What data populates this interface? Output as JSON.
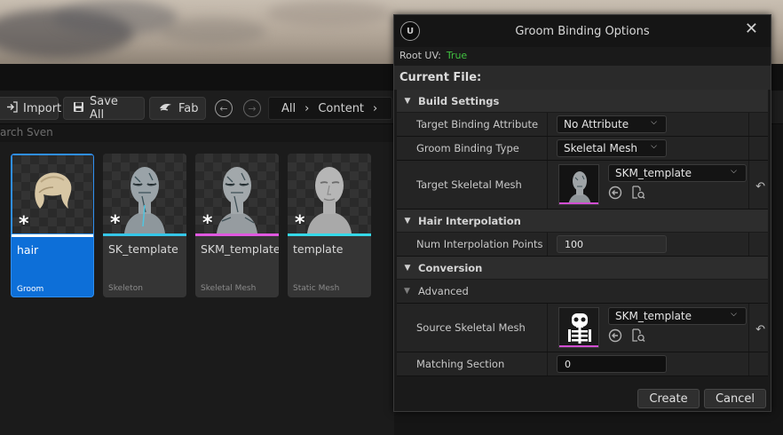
{
  "toolbar": {
    "import_label": "Import",
    "save_all_label": "Save All",
    "fab_label": "Fab",
    "breadcrumb": [
      "All",
      "Content"
    ]
  },
  "search": {
    "placeholder": "arch Sven"
  },
  "assets": [
    {
      "name": "hair",
      "type": "Groom",
      "accent": "#ffffff",
      "selected": true
    },
    {
      "name": "SK_template",
      "type": "Skeleton",
      "accent": "#35c6e8",
      "selected": false
    },
    {
      "name": "SKM_template",
      "type": "Skeletal Mesh",
      "accent": "#e058e0",
      "selected": false
    },
    {
      "name": "template",
      "type": "Static Mesh",
      "accent": "#35d8e8",
      "selected": false
    }
  ],
  "dialog": {
    "title": "Groom Binding Options",
    "root_uv_label": "Root UV:",
    "root_uv_value": "True",
    "current_file_label": "Current File:",
    "build_settings": {
      "label": "Build Settings",
      "target_binding_attribute": {
        "label": "Target Binding Attribute",
        "value": "No Attribute"
      },
      "groom_binding_type": {
        "label": "Groom Binding Type",
        "value": "Skeletal Mesh"
      },
      "target_skeletal_mesh": {
        "label": "Target Skeletal Mesh",
        "value": "SKM_template"
      }
    },
    "hair_interpolation": {
      "label": "Hair Interpolation",
      "num_interpolation_points": {
        "label": "Num Interpolation Points",
        "value": "100"
      }
    },
    "conversion": {
      "label": "Conversion",
      "advanced_label": "Advanced",
      "source_skeletal_mesh": {
        "label": "Source Skeletal Mesh",
        "value": "SKM_template"
      },
      "matching_section": {
        "label": "Matching Section",
        "value": "0"
      }
    },
    "create_label": "Create",
    "cancel_label": "Cancel"
  },
  "colors": {
    "selection_blue": "#0d6fd8",
    "true_green": "#41c241",
    "skeletal_mesh_accent": "#d24ed2"
  }
}
